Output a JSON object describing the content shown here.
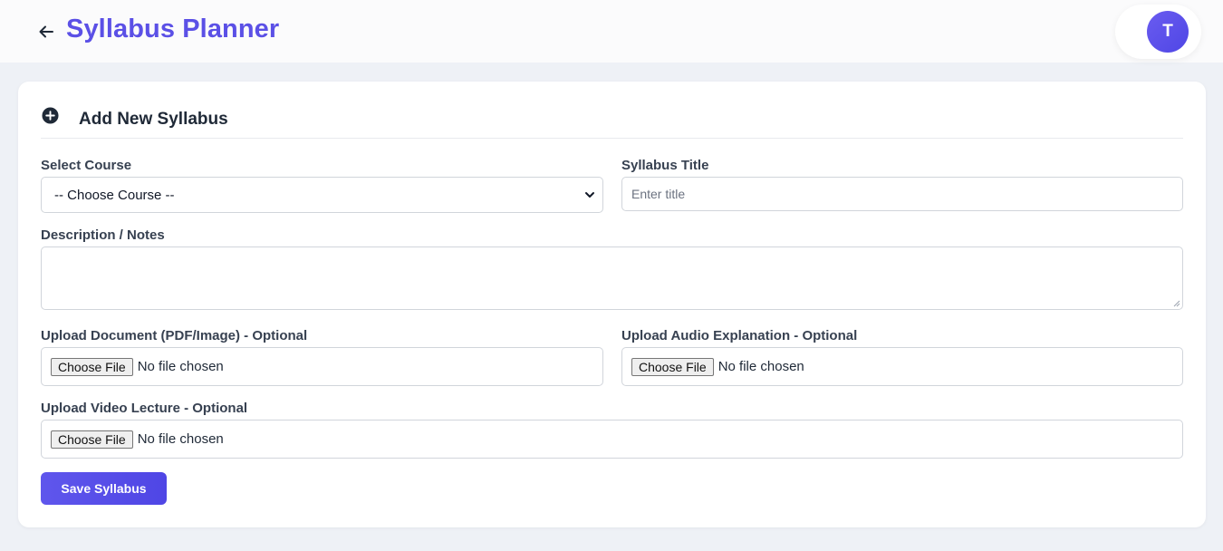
{
  "header": {
    "title": "Syllabus Planner",
    "avatar_initial": "T"
  },
  "form": {
    "title": "Add New Syllabus",
    "course": {
      "label": "Select Course",
      "selected": "-- Choose Course --"
    },
    "syllabus_title": {
      "label": "Syllabus Title",
      "placeholder": "Enter title"
    },
    "description": {
      "label": "Description / Notes"
    },
    "upload_document": {
      "label": "Upload Document (PDF/Image) - Optional",
      "button": "Choose File",
      "status": "No file chosen"
    },
    "upload_audio": {
      "label": "Upload Audio Explanation - Optional",
      "button": "Choose File",
      "status": "No file chosen"
    },
    "upload_video": {
      "label": "Upload Video Lecture - Optional",
      "button": "Choose File",
      "status": "No file chosen"
    },
    "save_label": "Save Syllabus"
  },
  "icons": {
    "back": "arrow-left-icon",
    "add": "plus-circle-icon",
    "dropdown": "chevron-down-icon"
  },
  "colors": {
    "accent": "#5b50e6",
    "button": "#4f46e5",
    "background": "#eef1f6"
  }
}
